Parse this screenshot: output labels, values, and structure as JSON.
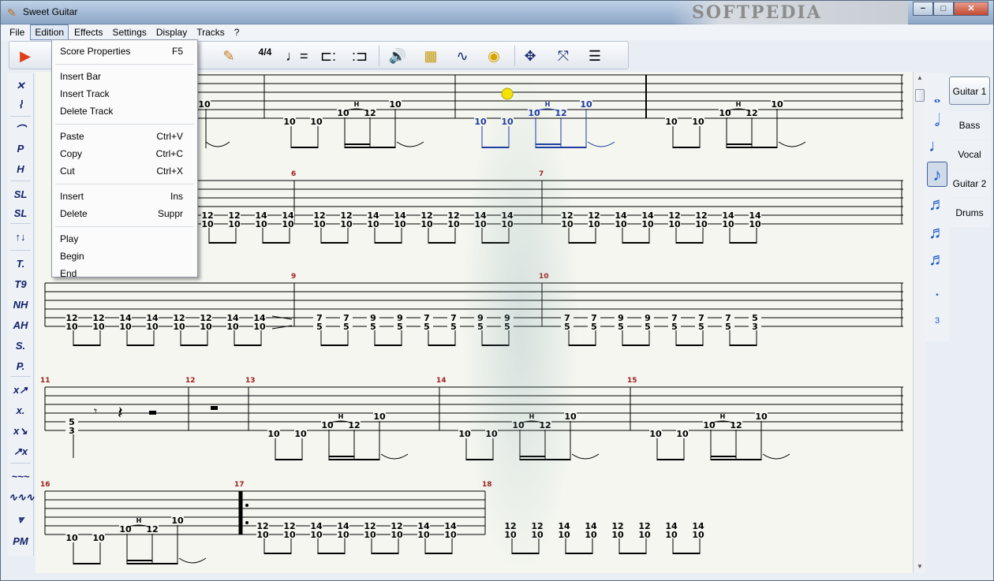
{
  "window": {
    "title": "Sweet Guitar",
    "watermark": "SOFTPEDIA",
    "controls": [
      "−",
      "□",
      "✕"
    ]
  },
  "menu": [
    "File",
    "Edition",
    "Effects",
    "Settings",
    "Display",
    "Tracks",
    "?"
  ],
  "dropdown": {
    "groups": [
      [
        {
          "label": "Score Properties",
          "shortcut": "F5"
        }
      ],
      [
        {
          "label": "Insert Bar",
          "shortcut": ""
        },
        {
          "label": "Insert Track",
          "shortcut": ""
        },
        {
          "label": "Delete Track",
          "shortcut": ""
        }
      ],
      [
        {
          "label": "Paste",
          "shortcut": "Ctrl+V"
        },
        {
          "label": "Copy",
          "shortcut": "Ctrl+C"
        },
        {
          "label": "Cut",
          "shortcut": "Ctrl+X"
        }
      ],
      [
        {
          "label": "Insert",
          "shortcut": "Ins"
        },
        {
          "label": "Delete",
          "shortcut": "Suppr"
        }
      ],
      [
        {
          "label": "Play",
          "shortcut": ""
        },
        {
          "label": "Begin",
          "shortcut": ""
        },
        {
          "label": "End",
          "shortcut": ""
        }
      ]
    ]
  },
  "toolbar": {
    "icons": [
      "play-icon",
      "guitar-icon",
      "time-signature-icon",
      "tempo-icon",
      "repeat-start-icon",
      "repeat-end-icon",
      "volume-icon",
      "amplifier-icon",
      "sine-wave-icon",
      "tuner-icon",
      "move-icon",
      "collapse-icon",
      "list-view-icon"
    ],
    "time_signature": "4/4"
  },
  "left_tools": [
    "✕",
    "⌇",
    "⌒",
    "P",
    "H",
    "SL",
    "SL",
    "↑↓",
    "T.",
    "T9",
    "NH",
    "AH",
    "S.",
    "P.",
    "x↗",
    "x.",
    "x↘",
    "↗x",
    "~~~",
    "∿∿∿",
    "⩔",
    "PM"
  ],
  "durations": [
    "whole",
    "half",
    "quarter",
    "eighth",
    "sixteenth",
    "thirty-second",
    "sixty-fourth",
    "dot",
    "triplet"
  ],
  "durations_triplet_label": "3",
  "tracks": [
    "Guitar 1",
    "Bass",
    "Vocal",
    "Guitar 2",
    "Drums"
  ],
  "score": {
    "measure_numbers": [
      "6",
      "7",
      "9",
      "10",
      "11",
      "12",
      "13",
      "14",
      "15",
      "16",
      "17",
      "18"
    ],
    "fret_values": [
      "10",
      "12",
      "14",
      "7",
      "9",
      "5",
      "3",
      "H"
    ]
  }
}
